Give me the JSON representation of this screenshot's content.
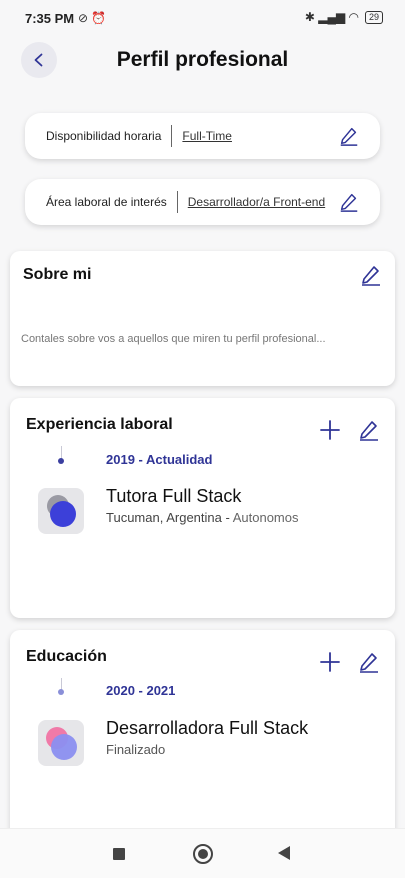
{
  "status_bar": {
    "time": "7:35 PM",
    "left_icons": "⊘ ⏰",
    "right_icons": "✱ ▂▄▆ ◠",
    "battery": "29"
  },
  "header": {
    "title": "Perfil profesional"
  },
  "availability": {
    "label": "Disponibilidad horaria",
    "value": "Full-Time"
  },
  "work_area": {
    "label": "Área laboral de interés",
    "value": "Desarrollador/a Front-end"
  },
  "about": {
    "title": "Sobre mi",
    "placeholder": "Contales sobre vos a aquellos que miren tu perfil profesional..."
  },
  "experience": {
    "title": "Experiencia laboral",
    "items": [
      {
        "period": "2019 - Actualidad",
        "role": "Tutora Full Stack",
        "location": "Tucuman,  Argentina",
        "separator": " - ",
        "company": "Autonomos"
      }
    ]
  },
  "education": {
    "title": "Educación",
    "items": [
      {
        "period": "2020 - 2021",
        "degree": "Desarrolladora Full Stack",
        "status": "Finalizado"
      }
    ]
  },
  "colors": {
    "accent": "#2f3496",
    "dot_exp": "#3b3fa0",
    "dot_edu": "#8a8fd8"
  }
}
